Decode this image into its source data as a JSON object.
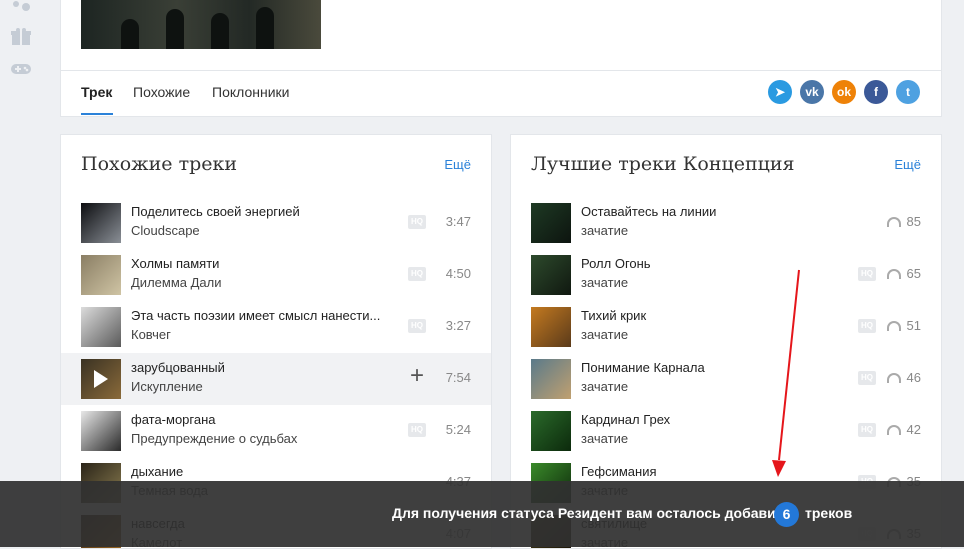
{
  "tabs": [
    "Трек",
    "Похожие",
    "Поклонники"
  ],
  "share": [
    {
      "icon": "telegram-icon",
      "glyph": "➤",
      "color": "#2a9ae1"
    },
    {
      "icon": "vk-icon",
      "glyph": "vk",
      "color": "#4a76a8"
    },
    {
      "icon": "odnoklassniki-icon",
      "glyph": "ok",
      "color": "#ee8208"
    },
    {
      "icon": "facebook-icon",
      "glyph": "f",
      "color": "#3b5998"
    },
    {
      "icon": "twitter-icon",
      "glyph": "t",
      "color": "#4ea1e1"
    }
  ],
  "similar": {
    "title": "Похожие треки",
    "more": "Ещё",
    "tracks": [
      {
        "title": "Поделитесь своей энергией",
        "artist": "Cloudscape",
        "duration": "3:47",
        "hq": "HQ",
        "colors": [
          "#0c0d10",
          "#8a8f96"
        ]
      },
      {
        "title": "Холмы памяти",
        "artist": "Дилемма Дали",
        "duration": "4:50",
        "hq": "HQ",
        "colors": [
          "#8a7e64",
          "#cfc4a4"
        ]
      },
      {
        "title": "Эта часть поэзии имеет смысл нанести...",
        "artist": "Ковчег",
        "duration": "3:27",
        "hq": "HQ",
        "colors": [
          "#dcdcdc",
          "#5a5a5a"
        ]
      },
      {
        "title": "зарубцованный",
        "artist": "Искупление",
        "duration": "7:54",
        "hq": "",
        "plus": "+",
        "colors": [
          "#3a3223",
          "#8a6a3a"
        ],
        "playing": true
      },
      {
        "title": "фата-моргана",
        "artist": "Предупреждение о судьбах",
        "duration": "5:24",
        "hq": "HQ",
        "colors": [
          "#e8e8e8",
          "#2a2a2a"
        ]
      },
      {
        "title": "дыхание",
        "artist": "Темная вода",
        "duration": "4:37",
        "hq": "",
        "colors": [
          "#2a2418",
          "#8a7c50"
        ]
      },
      {
        "title": "навсегда",
        "artist": "Камелот",
        "duration": "4:07",
        "hq": "",
        "colors": [
          "#3a2410",
          "#a06a20"
        ]
      }
    ]
  },
  "best": {
    "title": "Лучшие треки Концепция",
    "more": "Ещё",
    "tracks": [
      {
        "title": "Оставайтесь на линии",
        "artist": "зачатие",
        "listens": "85",
        "hq": "",
        "colors": [
          "#1e3a24",
          "#0d140f"
        ]
      },
      {
        "title": "Ролл Огонь",
        "artist": "зачатие",
        "listens": "65",
        "hq": "HQ",
        "colors": [
          "#2d4a2c",
          "#101810"
        ]
      },
      {
        "title": "Тихий крик",
        "artist": "зачатие",
        "listens": "51",
        "hq": "HQ",
        "colors": [
          "#c47a20",
          "#5a3a1a"
        ]
      },
      {
        "title": "Понимание Карнала",
        "artist": "зачатие",
        "listens": "46",
        "hq": "HQ",
        "colors": [
          "#5a7a8a",
          "#c0a070"
        ]
      },
      {
        "title": "Кардинал Грех",
        "artist": "зачатие",
        "listens": "42",
        "hq": "HQ",
        "colors": [
          "#2a6a2a",
          "#0c2a0c"
        ]
      },
      {
        "title": "Гефсимания",
        "artist": "зачатие",
        "listens": "35",
        "hq": "HQ",
        "colors": [
          "#3a8a2a",
          "#0e2a0c"
        ]
      },
      {
        "title": "святилище",
        "artist": "зачатие",
        "listens": "35",
        "hq": "HQ",
        "colors": [
          "#4a4018",
          "#1a1408"
        ]
      }
    ]
  },
  "notice": {
    "before": "Для получения статуса Резидент вам осталось добавить",
    "count": "6",
    "after": "треков"
  }
}
